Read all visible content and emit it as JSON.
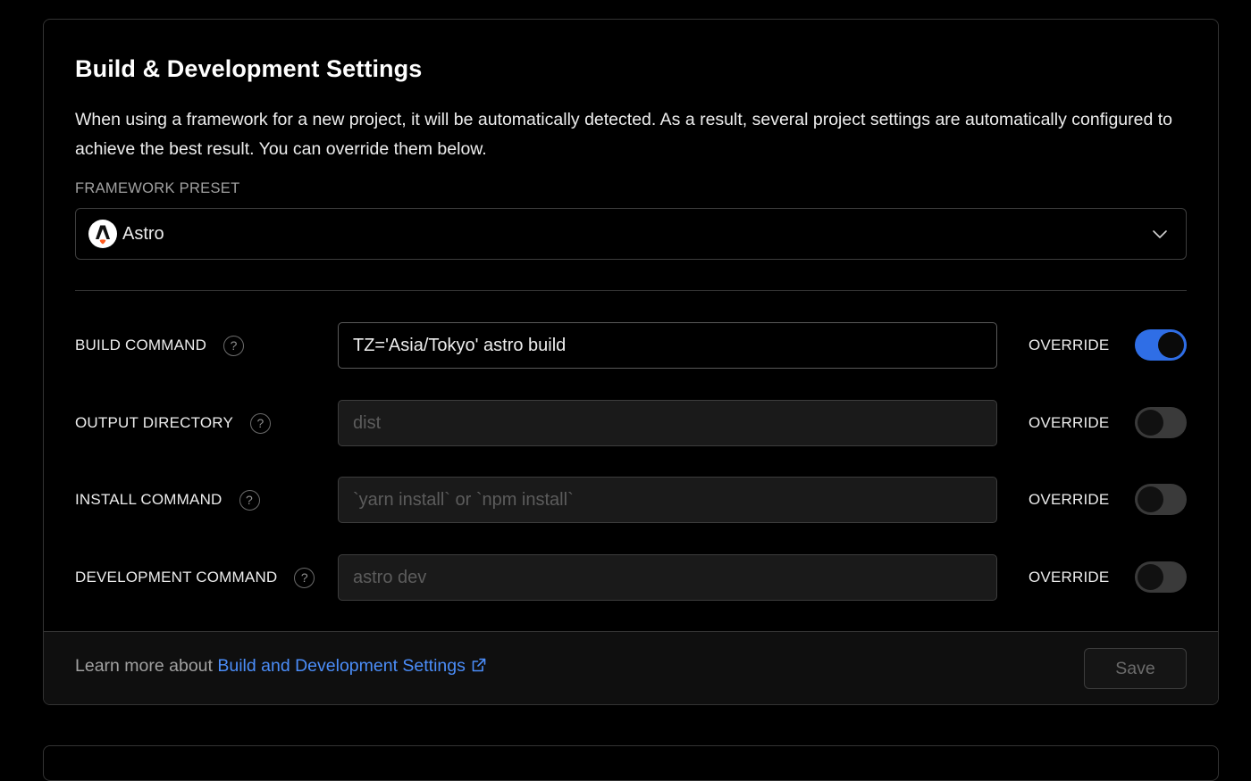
{
  "section": {
    "title": "Build & Development Settings",
    "description": "When using a framework for a new project, it will be automatically detected. As a result, several project settings are automatically configured to achieve the best result. You can override them below."
  },
  "framework_preset": {
    "label": "FRAMEWORK PRESET",
    "selected": "Astro",
    "icon": "astro-logo-icon"
  },
  "settings": [
    {
      "label": "BUILD COMMAND",
      "value": "TZ='Asia/Tokyo' astro build",
      "placeholder": "",
      "override_label": "OVERRIDE",
      "override": true
    },
    {
      "label": "OUTPUT DIRECTORY",
      "value": "",
      "placeholder": "dist",
      "override_label": "OVERRIDE",
      "override": false
    },
    {
      "label": "INSTALL COMMAND",
      "value": "",
      "placeholder": "`yarn install` or `npm install`",
      "override_label": "OVERRIDE",
      "override": false
    },
    {
      "label": "DEVELOPMENT COMMAND",
      "value": "",
      "placeholder": "astro dev",
      "override_label": "OVERRIDE",
      "override": false
    }
  ],
  "footer": {
    "prefix": "Learn more about ",
    "link_text": "Build and Development Settings",
    "save_label": "Save"
  },
  "colors": {
    "accent": "#2f6ee6",
    "link": "#4b8df8",
    "background": "#000000",
    "border": "#333333"
  }
}
